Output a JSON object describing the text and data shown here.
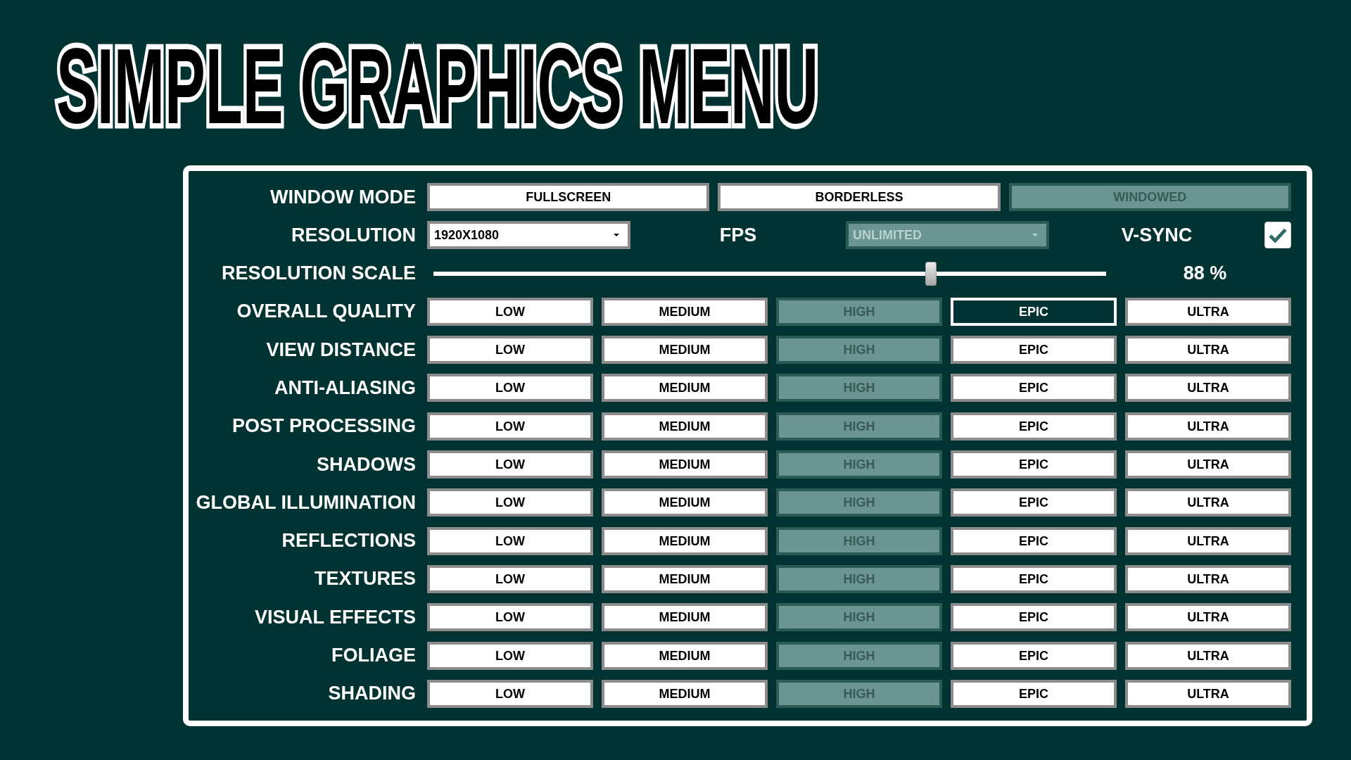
{
  "title": "SIMPLE GRAPHICS MENU",
  "window_mode": {
    "label": "WINDOW MODE",
    "options": [
      {
        "label": "FULLSCREEN",
        "selected": false
      },
      {
        "label": "BORDERLESS",
        "selected": false
      },
      {
        "label": "WINDOWED",
        "selected": true
      }
    ]
  },
  "resolution": {
    "label": "RESOLUTION",
    "value": "1920X1080",
    "disabled": false
  },
  "fps": {
    "label": "FPS",
    "value": "UNLIMITED",
    "disabled": true
  },
  "vsync": {
    "label": "V-SYNC",
    "checked": true
  },
  "resolution_scale": {
    "label": "RESOLUTION SCALE",
    "level": 0.74,
    "reading": "88 %"
  },
  "quality_settings": [
    {
      "label": "OVERALL QUALITY",
      "options": [
        {
          "label": "LOW",
          "selected": false,
          "highlighted": false
        },
        {
          "label": "MEDIUM",
          "selected": false,
          "highlighted": false
        },
        {
          "label": "HIGH",
          "selected": true,
          "highlighted": false
        },
        {
          "label": "EPIC",
          "selected": false,
          "highlighted": true
        },
        {
          "label": "ULTRA",
          "selected": false,
          "highlighted": false
        }
      ]
    },
    {
      "label": "VIEW DISTANCE",
      "options": [
        {
          "label": "LOW",
          "selected": false,
          "highlighted": false
        },
        {
          "label": "MEDIUM",
          "selected": false,
          "highlighted": false
        },
        {
          "label": "HIGH",
          "selected": true,
          "highlighted": false
        },
        {
          "label": "EPIC",
          "selected": false,
          "highlighted": false
        },
        {
          "label": "ULTRA",
          "selected": false,
          "highlighted": false
        }
      ]
    },
    {
      "label": "ANTI-ALIASING",
      "options": [
        {
          "label": "LOW",
          "selected": false,
          "highlighted": false
        },
        {
          "label": "MEDIUM",
          "selected": false,
          "highlighted": false
        },
        {
          "label": "HIGH",
          "selected": true,
          "highlighted": false
        },
        {
          "label": "EPIC",
          "selected": false,
          "highlighted": false
        },
        {
          "label": "ULTRA",
          "selected": false,
          "highlighted": false
        }
      ]
    },
    {
      "label": "POST PROCESSING",
      "options": [
        {
          "label": "LOW",
          "selected": false,
          "highlighted": false
        },
        {
          "label": "MEDIUM",
          "selected": false,
          "highlighted": false
        },
        {
          "label": "HIGH",
          "selected": true,
          "highlighted": false
        },
        {
          "label": "EPIC",
          "selected": false,
          "highlighted": false
        },
        {
          "label": "ULTRA",
          "selected": false,
          "highlighted": false
        }
      ]
    },
    {
      "label": "SHADOWS",
      "options": [
        {
          "label": "LOW",
          "selected": false,
          "highlighted": false
        },
        {
          "label": "MEDIUM",
          "selected": false,
          "highlighted": false
        },
        {
          "label": "HIGH",
          "selected": true,
          "highlighted": false
        },
        {
          "label": "EPIC",
          "selected": false,
          "highlighted": false
        },
        {
          "label": "ULTRA",
          "selected": false,
          "highlighted": false
        }
      ]
    },
    {
      "label": "GLOBAL ILLUMINATION",
      "options": [
        {
          "label": "LOW",
          "selected": false,
          "highlighted": false
        },
        {
          "label": "MEDIUM",
          "selected": false,
          "highlighted": false
        },
        {
          "label": "HIGH",
          "selected": true,
          "highlighted": false
        },
        {
          "label": "EPIC",
          "selected": false,
          "highlighted": false
        },
        {
          "label": "ULTRA",
          "selected": false,
          "highlighted": false
        }
      ]
    },
    {
      "label": "REFLECTIONS",
      "options": [
        {
          "label": "LOW",
          "selected": false,
          "highlighted": false
        },
        {
          "label": "MEDIUM",
          "selected": false,
          "highlighted": false
        },
        {
          "label": "HIGH",
          "selected": true,
          "highlighted": false
        },
        {
          "label": "EPIC",
          "selected": false,
          "highlighted": false
        },
        {
          "label": "ULTRA",
          "selected": false,
          "highlighted": false
        }
      ]
    },
    {
      "label": "TEXTURES",
      "options": [
        {
          "label": "LOW",
          "selected": false,
          "highlighted": false
        },
        {
          "label": "MEDIUM",
          "selected": false,
          "highlighted": false
        },
        {
          "label": "HIGH",
          "selected": true,
          "highlighted": false
        },
        {
          "label": "EPIC",
          "selected": false,
          "highlighted": false
        },
        {
          "label": "ULTRA",
          "selected": false,
          "highlighted": false
        }
      ]
    },
    {
      "label": "VISUAL EFFECTS",
      "options": [
        {
          "label": "LOW",
          "selected": false,
          "highlighted": false
        },
        {
          "label": "MEDIUM",
          "selected": false,
          "highlighted": false
        },
        {
          "label": "HIGH",
          "selected": true,
          "highlighted": false
        },
        {
          "label": "EPIC",
          "selected": false,
          "highlighted": false
        },
        {
          "label": "ULTRA",
          "selected": false,
          "highlighted": false
        }
      ]
    },
    {
      "label": "FOLIAGE",
      "options": [
        {
          "label": "LOW",
          "selected": false,
          "highlighted": false
        },
        {
          "label": "MEDIUM",
          "selected": false,
          "highlighted": false
        },
        {
          "label": "HIGH",
          "selected": true,
          "highlighted": false
        },
        {
          "label": "EPIC",
          "selected": false,
          "highlighted": false
        },
        {
          "label": "ULTRA",
          "selected": false,
          "highlighted": false
        }
      ]
    },
    {
      "label": "SHADING",
      "options": [
        {
          "label": "LOW",
          "selected": false,
          "highlighted": false
        },
        {
          "label": "MEDIUM",
          "selected": false,
          "highlighted": false
        },
        {
          "label": "HIGH",
          "selected": true,
          "highlighted": false
        },
        {
          "label": "EPIC",
          "selected": false,
          "highlighted": false
        },
        {
          "label": "ULTRA",
          "selected": false,
          "highlighted": false
        }
      ]
    }
  ]
}
